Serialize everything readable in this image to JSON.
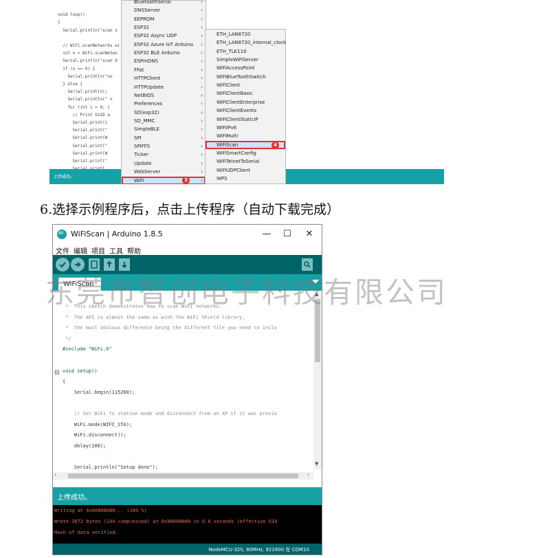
{
  "top_screenshot": {
    "code_lines": [
      "",
      "void loop()",
      "{",
      "  Serial.println(\"scan s",
      "",
      "  // WiFi.scanNetworks wi",
      "  int n = WiFi.scanNetwo",
      "  Serial.println(\"scan d",
      "  if (n == 0) {",
      "    Serial.println(\"no",
      "  } else {",
      "    Serial.print(n);",
      "    Serial.println(\" n",
      "    for (int i = 0; i",
      "      // Print SSID a",
      "      Serial.print(i",
      "      Serial.print(\"",
      "      Serial.print(W",
      "      Serial.print(\"",
      "      Serial.print(W",
      "      Serial.print(\"",
      "      Serial.printl"
    ],
    "status_text": "上传成功。",
    "menu_items": [
      "BluetoothSerial",
      "DNSServer",
      "EEPROM",
      "ESP32",
      "ESP32 Async UDP",
      "ESP32 Azure IoT Arduino",
      "ESP32 BLE Arduino",
      "ESPmDNS",
      "FFat",
      "HTTPClient",
      "HTTPUpdate",
      "NetBIOS",
      "Preferences",
      "SD(esp32)",
      "SD_MMC",
      "SimpleBLE",
      "SPI",
      "SPIFFS",
      "Ticker",
      "Update",
      "WebServer",
      "WiFi"
    ],
    "submenu_items": [
      "ETH_LAN8720",
      "ETH_LAN8720_internal_clock",
      "ETH_TLK110",
      "SimpleWiFiServer",
      "WiFiAccessPoint",
      "WiFiBlueToothSwitch",
      "WiFiClient",
      "WiFiClientBasic",
      "WiFiClientEnterprise",
      "WiFiClientEvents",
      "WiFiClientStaticIP",
      "WiFiIPv6",
      "WiFiMulti",
      "WiFiScan",
      "WiFiSmartConfig",
      "WiFiTelnetToSerial",
      "WiFiUDPClient",
      "WPS"
    ],
    "badge_wifi": "3",
    "badge_scan": "4"
  },
  "caption": "6.选择示例程序后，点击上传程序（自动下载完成）",
  "window": {
    "title": "WiFiScan | Arduino 1.8.5",
    "minimize": "—",
    "maximize": "☐",
    "close": "✕",
    "menus": [
      "文件",
      "编辑",
      "项目",
      "工具",
      "帮助"
    ],
    "tab_label": "WiFiScan",
    "code": [
      " *  This sketch demonstrates how to scan WiFi networks.",
      " *  The API is almost the same as with the WiFi Shield library,",
      " *  the most obvious difference being the different file you need to inclu",
      " */",
      "#include \"WiFi.h\"",
      "",
      "void setup()",
      "{",
      "    Serial.begin(115200);",
      "",
      "    // Set WiFi to station mode and disconnect from an AP if it was previo",
      "    WiFi.mode(WIFI_STA);",
      "    WiFi.disconnect();",
      "    delay(100);",
      "",
      "    Serial.println(\"Setup done\");"
    ],
    "status_text": "上传成功。",
    "console_lines": [
      "Writing at 0x00008000... (100 %)",
      "Wrote 3072 bytes (144 compressed) at 0x00008000 in 0.0 seconds (effective 614",
      "Hash of data verified."
    ],
    "board_info": "NodeMCU-32S, 80MHz, 921600 在 COM10"
  },
  "watermark": "东莞市智创电子科技有限公司",
  "colors": {
    "arduino_teal": "#17a1a5",
    "arduino_dark": "#006468",
    "highlight_red": "#e0303a",
    "console_text": "#e06a4a"
  }
}
